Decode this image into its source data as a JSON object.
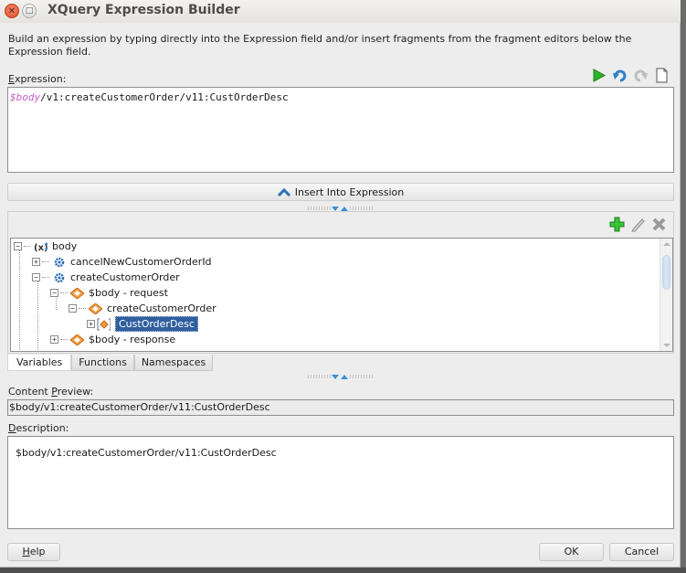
{
  "window": {
    "title": "XQuery Expression Builder",
    "close_icon": "close-icon",
    "maximize_icon": "maximize-icon"
  },
  "intro_text": "Build an expression by typing directly into the Expression field and/or insert fragments from the fragment editors below the Expression field.",
  "expression": {
    "label_mnemonic": "E",
    "label_rest": "xpression:",
    "value_var": "$body",
    "value_rest": "/v1:createCustomerOrder/v11:CustOrderDesc",
    "toolbar": [
      "run-icon",
      "undo-icon",
      "redo-icon",
      "new-document-icon"
    ]
  },
  "insert_button": {
    "label": "Insert Into Expression",
    "icon": "chevron-up-icon"
  },
  "fragment_tools": [
    "add-icon",
    "edit-icon",
    "delete-icon"
  ],
  "tree": [
    {
      "label": "body",
      "icon": "variable-icon",
      "expander": "−",
      "level": 0
    },
    {
      "label": "cancelNewCustomerOrderId",
      "icon": "operation-gear-icon",
      "expander": "+",
      "level": 1
    },
    {
      "label": "createCustomerOrder",
      "icon": "operation-gear-icon",
      "expander": "−",
      "level": 1
    },
    {
      "label": "$body - request",
      "icon": "element-icon",
      "expander": "−",
      "level": 2
    },
    {
      "label": "createCustomerOrder",
      "icon": "element-icon",
      "expander": "−",
      "level": 3
    },
    {
      "label": "CustOrderDesc",
      "icon": "element-bracket-icon",
      "expander": "+",
      "level": 4,
      "selected": true
    },
    {
      "label": "$body - response",
      "icon": "element-icon",
      "expander": "+",
      "level": 2
    }
  ],
  "tabs": [
    {
      "label": "Variables",
      "active": true
    },
    {
      "label": "Functions",
      "active": false
    },
    {
      "label": "Namespaces",
      "active": false
    }
  ],
  "content_preview": {
    "label_pre": "Content ",
    "label_mnemonic": "P",
    "label_rest": "review:",
    "value": "$body/v1:createCustomerOrder/v11:CustOrderDesc"
  },
  "description": {
    "label_mnemonic": "D",
    "label_rest": "escription:",
    "value": "$body/v1:createCustomerOrder/v11:CustOrderDesc"
  },
  "buttons": {
    "help_mnemonic": "H",
    "help_rest": "elp",
    "ok": "OK",
    "cancel": "Cancel"
  },
  "colors": {
    "accent_blue": "#2f5f9e",
    "run_green": "#2bb32b",
    "variable_purple": "#c65cc6",
    "element_orange": "#e07b2a"
  }
}
